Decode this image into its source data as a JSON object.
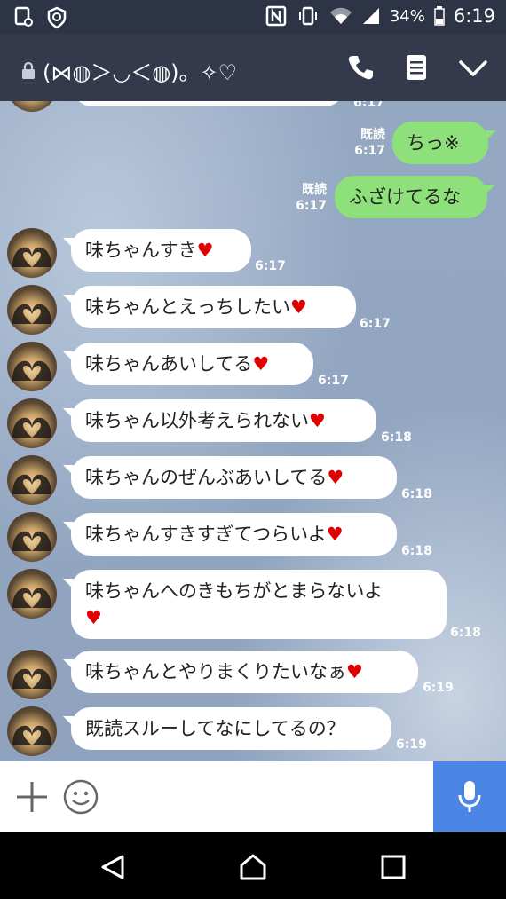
{
  "status_bar": {
    "battery": "34%",
    "time": "6:19"
  },
  "header": {
    "title": "(⋈◍＞◡＜◍)。✧♡"
  },
  "messages": [
    {
      "side": "out",
      "text": "ちっ※",
      "read": "既読",
      "time": "6:17"
    },
    {
      "side": "out",
      "text": "ふざけてるな",
      "read": "既読",
      "time": "6:17"
    },
    {
      "side": "in",
      "text": "味ちゃんすき",
      "heart": "♥",
      "time": "6:17"
    },
    {
      "side": "in",
      "text": "味ちゃんとえっちしたい",
      "heart": "♥",
      "time": "6:17"
    },
    {
      "side": "in",
      "text": "味ちゃんあいしてる",
      "heart": "♥",
      "time": "6:17"
    },
    {
      "side": "in",
      "text": "味ちゃん以外考えられない",
      "heart": "♥",
      "time": "6:18"
    },
    {
      "side": "in",
      "text": "味ちゃんのぜんぶあいしてる",
      "heart": "♥",
      "time": "6:18"
    },
    {
      "side": "in",
      "text": "味ちゃんすきすぎてつらいよ",
      "heart": "♥",
      "time": "6:18"
    },
    {
      "side": "in",
      "text": "味ちゃんへのきもちがとまらないよ",
      "heart": "♥",
      "time": "6:18"
    },
    {
      "side": "in",
      "text": "味ちゃんとやりまくりたいなぁ",
      "heart": "♥",
      "time": "6:19"
    },
    {
      "side": "in",
      "text": "既読スルーしてなにしてるの？",
      "time": "6:19"
    }
  ],
  "icons": {
    "status_left": [
      "settings-screenshot-icon",
      "shield-icon"
    ],
    "status_right": [
      "nfc-icon",
      "vibrate-icon",
      "wifi-icon",
      "signal-icon"
    ],
    "header": [
      "lock-icon",
      "phone-icon",
      "menu-icon",
      "chevron-down-icon"
    ],
    "input": [
      "plus-icon",
      "emoji-icon",
      "microphone-icon"
    ],
    "nav": [
      "back-icon",
      "home-icon",
      "recents-icon"
    ]
  },
  "colors": {
    "header": "#343a4c",
    "sent_bubble": "#8de07a",
    "received_bubble": "#ffffff",
    "heart": "#e00000",
    "mic": "#4b86e6"
  }
}
